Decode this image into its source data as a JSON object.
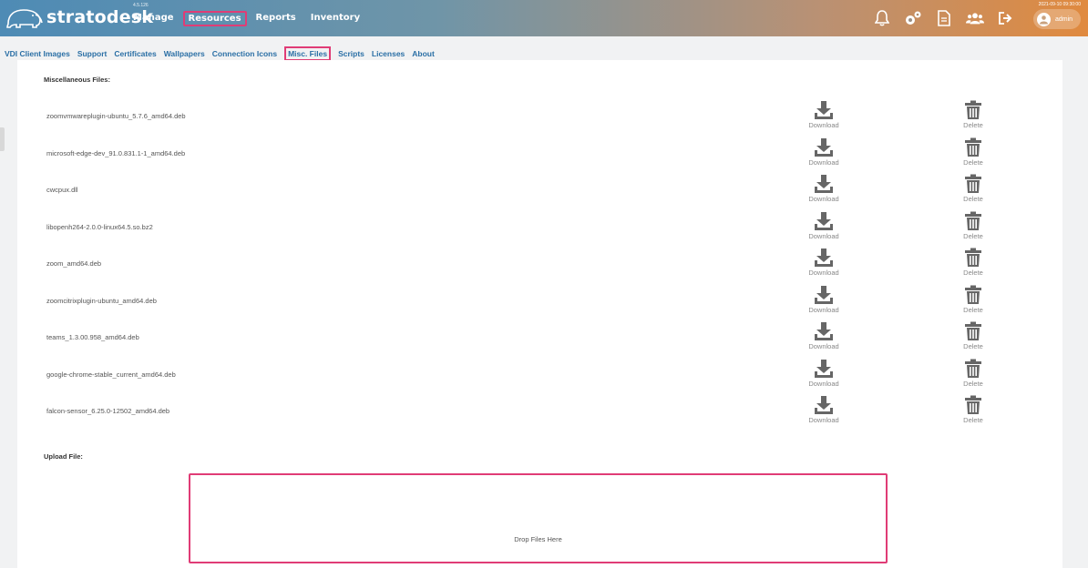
{
  "app": {
    "name": "stratodesk",
    "version": "4.5.126",
    "datetime": "2021-09-10 09:30:00",
    "user": "admin"
  },
  "main_nav": [
    {
      "label": "Manage",
      "active": false
    },
    {
      "label": "Resources",
      "active": true
    },
    {
      "label": "Reports",
      "active": false
    },
    {
      "label": "Inventory",
      "active": false
    }
  ],
  "top_icons": [
    "bell-icon",
    "gears-icon",
    "document-icon",
    "users-icon",
    "logout-icon"
  ],
  "sub_nav": [
    {
      "label": "VDI Client Images",
      "active": false
    },
    {
      "label": "Support",
      "active": false
    },
    {
      "label": "Certificates",
      "active": false
    },
    {
      "label": "Wallpapers",
      "active": false
    },
    {
      "label": "Connection Icons",
      "active": false
    },
    {
      "label": "Misc. Files",
      "active": true
    },
    {
      "label": "Scripts",
      "active": false
    },
    {
      "label": "Licenses",
      "active": false
    },
    {
      "label": "About",
      "active": false
    }
  ],
  "misc_files": {
    "title": "Miscellaneous Files:",
    "download_label": "Download",
    "delete_label": "Delete",
    "files": [
      "zoomvmwareplugin-ubuntu_5.7.6_amd64.deb",
      "microsoft-edge-dev_91.0.831.1-1_amd64.deb",
      "cwcpux.dll",
      "libopenh264-2.0.0-linux64.5.so.bz2",
      "zoom_amd64.deb",
      "zoomcitrixplugin-ubuntu_amd64.deb",
      "teams_1.3.00.958_amd64.deb",
      "google-chrome-stable_current_amd64.deb",
      "falcon-sensor_6.25.0-12502_amd64.deb"
    ]
  },
  "upload": {
    "title": "Upload File:",
    "dropzone_text": "Drop Files Here"
  },
  "colors": {
    "accent_highlight": "#e03c76",
    "link": "#2a6fa5",
    "gradient_start": "#4e8bb5",
    "gradient_end": "#e08a3f"
  }
}
